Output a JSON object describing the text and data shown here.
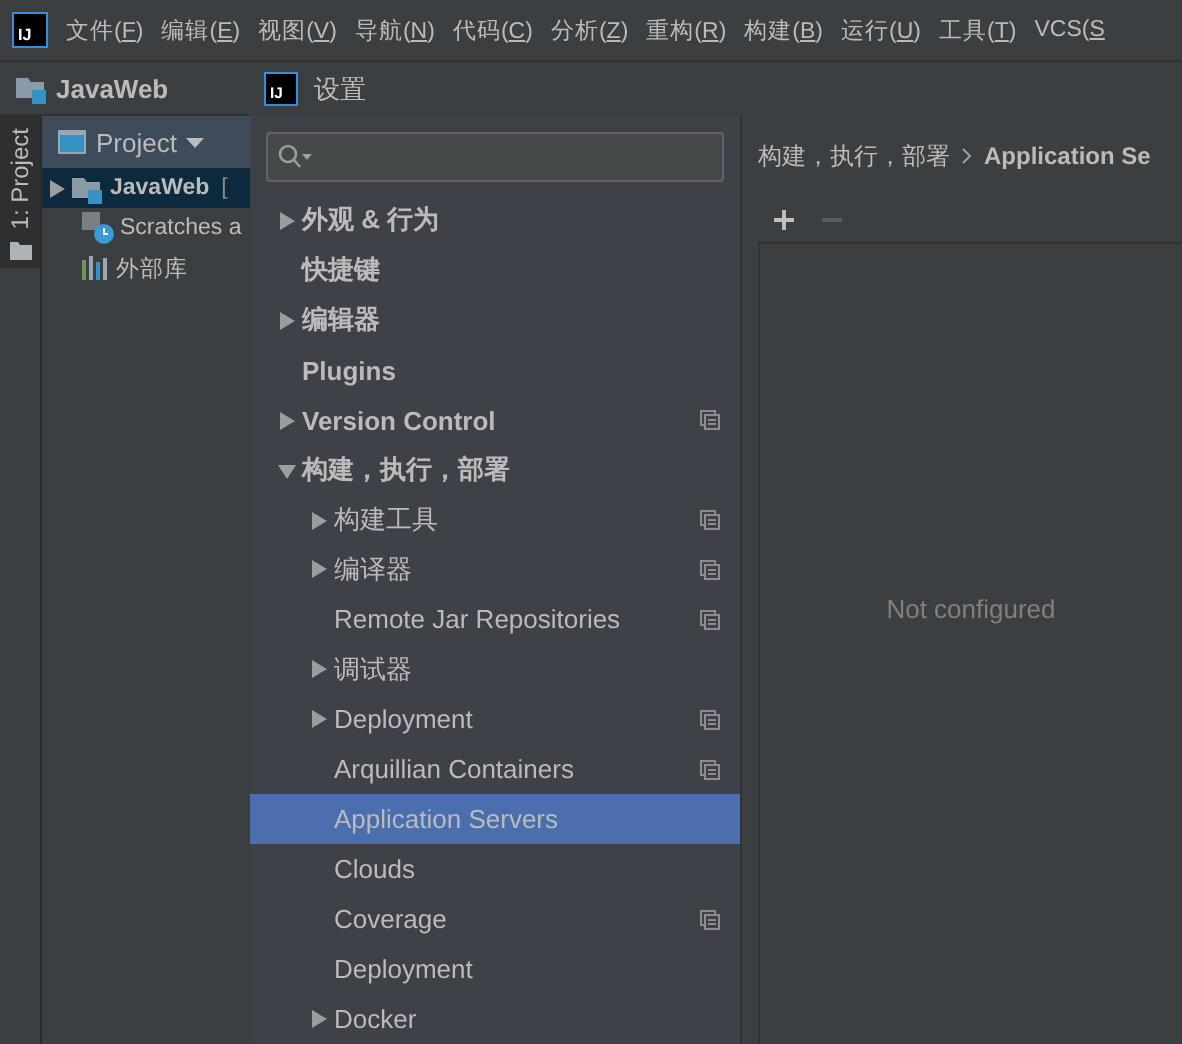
{
  "menu_bar": {
    "logo": "IJ",
    "items": [
      {
        "before": "文件(",
        "key": "F",
        "after": ")"
      },
      {
        "before": "编辑(",
        "key": "E",
        "after": ")"
      },
      {
        "before": "视图(",
        "key": "V",
        "after": ")"
      },
      {
        "before": "导航(",
        "key": "N",
        "after": ")"
      },
      {
        "before": "代码(",
        "key": "C",
        "after": ")"
      },
      {
        "before": "分析(",
        "key": "Z",
        "after": ")"
      },
      {
        "before": "重构(",
        "key": "R",
        "after": ")"
      },
      {
        "before": "构建(",
        "key": "B",
        "after": ")"
      },
      {
        "before": "运行(",
        "key": "U",
        "after": ")"
      },
      {
        "before": "工具(",
        "key": "T",
        "after": ")"
      },
      {
        "before": "VCS(",
        "key": "S"
      }
    ]
  },
  "nav_bar": {
    "project": "JavaWeb"
  },
  "tool_strip": {
    "tab": "1: Project",
    "selected": true
  },
  "project_panel": {
    "view": "Project",
    "items": [
      {
        "kind": "module",
        "label": "JavaWeb",
        "suffix": "[",
        "selected": true
      },
      {
        "kind": "scratches",
        "label": "Scratches a",
        "selected": false
      },
      {
        "kind": "library",
        "label": "外部库",
        "selected": false
      }
    ]
  },
  "dialog": {
    "logo": "IJ",
    "title": "设置",
    "tree": [
      {
        "kind": "group",
        "label": "外观 & 行为",
        "expanded": false,
        "shared": false,
        "selected": false
      },
      {
        "kind": "leaf",
        "label": "快捷键",
        "shared": false,
        "selected": false
      },
      {
        "kind": "group",
        "label": "编辑器",
        "expanded": false,
        "shared": false,
        "selected": false
      },
      {
        "kind": "leaf",
        "label": "Plugins",
        "shared": false,
        "selected": false
      },
      {
        "kind": "group",
        "label": "Version Control",
        "expanded": false,
        "shared": true,
        "selected": false
      },
      {
        "kind": "group",
        "label": "构建，执行，部署",
        "expanded": true,
        "shared": false,
        "selected": false,
        "children": [
          {
            "kind": "group",
            "label": "构建工具",
            "expanded": false,
            "shared": true,
            "selected": false
          },
          {
            "kind": "group",
            "label": "编译器",
            "expanded": false,
            "shared": true,
            "selected": false
          },
          {
            "kind": "leaf",
            "label": "Remote Jar Repositories",
            "shared": true,
            "selected": false
          },
          {
            "kind": "group",
            "label": "调试器",
            "expanded": false,
            "shared": false,
            "selected": false
          },
          {
            "kind": "group",
            "label": "Deployment",
            "expanded": false,
            "shared": true,
            "selected": false
          },
          {
            "kind": "leaf",
            "label": "Arquillian Containers",
            "shared": true,
            "selected": false
          },
          {
            "kind": "leaf",
            "label": "Application Servers",
            "shared": false,
            "selected": true
          },
          {
            "kind": "leaf",
            "label": "Clouds",
            "shared": false,
            "selected": false
          },
          {
            "kind": "leaf",
            "label": "Coverage",
            "shared": true,
            "selected": false
          },
          {
            "kind": "leaf",
            "label": "Deployment",
            "shared": false,
            "selected": false
          },
          {
            "kind": "group",
            "label": "Docker",
            "expanded": false,
            "shared": false,
            "selected": false
          }
        ]
      }
    ],
    "breadcrumb": [
      {
        "label": "构建，执行，部署"
      },
      {
        "label": "Application Se"
      }
    ],
    "toolbar": [
      {
        "kind": "add",
        "disabled": false
      },
      {
        "kind": "remove",
        "disabled": true
      }
    ],
    "empty_text": "Not configured"
  }
}
